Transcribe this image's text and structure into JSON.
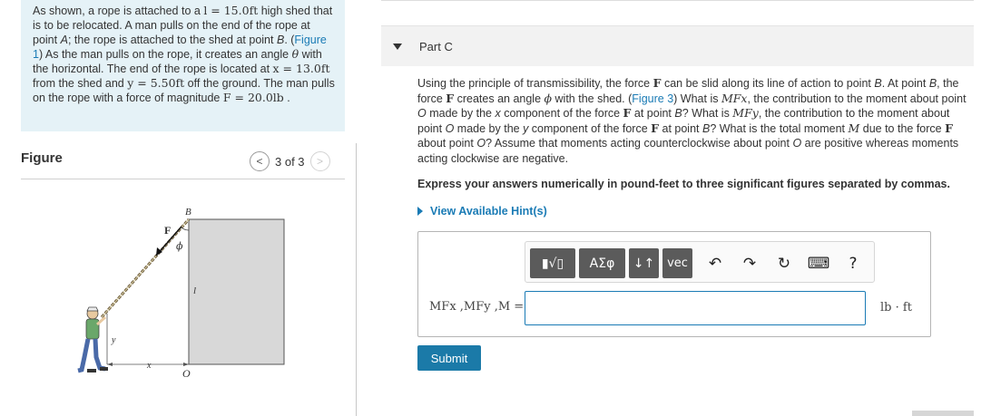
{
  "problem": {
    "p1": "As shown, a rope is attached to a ",
    "l_eq": "l = 15.0ft",
    "p2": " high shed that is to be relocated.  A man pulls on the end of the rope at point ",
    "pointA": "A",
    "p3": "; the rope is attached to the shed at point ",
    "pointB": "B",
    "p4": ". (",
    "fig_link": "Figure 1",
    "p5": ") As the man pulls on the rope, it creates an angle ",
    "theta": "θ",
    "p6": " with the horizontal.  The end of the rope is located at ",
    "x_eq": "x = 13.0ft",
    "p7": " from the shed and ",
    "y_eq": "y = 5.50ft",
    "p8": " off the ground.  The man pulls on the rope with a force of magnitude ",
    "F_eq": "F = 20.0lb",
    "p9": " ."
  },
  "figure": {
    "heading": "Figure",
    "nav_prev": "<",
    "nav_text": "3 of 3",
    "nav_next": ">",
    "labels": {
      "B": "B",
      "F": "F",
      "phi": "ϕ",
      "l": "l",
      "y": "y",
      "x": "x",
      "O": "O"
    }
  },
  "part": {
    "title": "Part C"
  },
  "question": {
    "q1": "Using the principle of transmissibility, the force ",
    "F": "F",
    "q2": " can be slid along its line of action to point ",
    "B1": "B",
    "q3": ". At point ",
    "B2": "B",
    "q4": ", the force ",
    "F2": "F",
    "q5": " creates an angle ",
    "phi": "ϕ",
    "q6": " with the shed. (",
    "fig_link": "Figure 3",
    "q7": ") What is ",
    "MFx": "MFx",
    "q8": ", the contribution to the moment about point ",
    "O1": "O",
    "q9": " made by the ",
    "xcomp": "x",
    "q10": " component of the force ",
    "F3": "F",
    "q11": " at point ",
    "B3": "B",
    "q12": "? What is ",
    "MFy": "MFy",
    "q13": ", the contribution to the moment about point ",
    "O2": "O",
    "q14": " made by the ",
    "ycomp": "y",
    "q15": " component of the force ",
    "F4": "F",
    "q16": " at point ",
    "B4": "B",
    "q17": "? What is the total moment ",
    "M": "M",
    "q18": " due to the force ",
    "F5": "F",
    "q19": " about point ",
    "O3": "O",
    "q20": "? Assume that moments acting counterclockwise about point ",
    "O4": "O",
    "q21": " are positive whereas moments acting clockwise are negative."
  },
  "instruction": "Express your answers numerically in pound-feet to three significant figures separated by commas.",
  "hint": "View Available Hint(s)",
  "toolbar": {
    "templates": "▮√▯",
    "greek": "ΑΣφ",
    "arrows": "↓↑",
    "vec": "vec",
    "undo": "↶",
    "redo": "↷",
    "reset": "↻",
    "keyboard": "⌨",
    "help": "?"
  },
  "answer": {
    "var_label": "MFx ,MFy ,M =",
    "value": "",
    "unit": "lb · ft"
  },
  "submit": "Submit",
  "colors": {
    "link": "#1a7bb5",
    "problem_bg": "#e5f2f7",
    "submit_bg": "#1b7aa8"
  }
}
